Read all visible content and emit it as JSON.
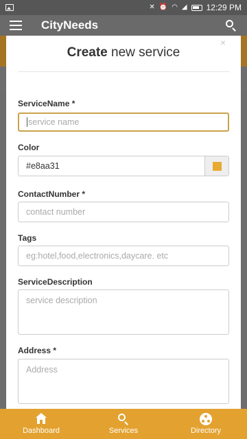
{
  "status_bar": {
    "time": "12:29 PM"
  },
  "app_bar": {
    "title": "CityNeeds"
  },
  "dialog": {
    "title_bold": "Create",
    "title_rest": " new service",
    "close": "×",
    "fields": {
      "service_name": {
        "label": "ServiceName *",
        "placeholder": "service name"
      },
      "color": {
        "label": "Color",
        "value": "#e8aa31"
      },
      "contact_number": {
        "label": "ContactNumber *",
        "placeholder": "contact number"
      },
      "tags": {
        "label": "Tags",
        "placeholder": "eg:hotel,food,electronics,daycare. etc"
      },
      "service_description": {
        "label": "ServiceDescription",
        "placeholder": "service description"
      },
      "address": {
        "label": "Address *",
        "placeholder": "Address"
      }
    }
  },
  "bottom_nav": {
    "items": [
      {
        "label": "Dashboard",
        "icon": "home-icon"
      },
      {
        "label": "Services",
        "icon": "search-icon"
      },
      {
        "label": "Directory",
        "icon": "directory-icon"
      }
    ]
  },
  "colors": {
    "accent": "#e3a230",
    "swatch": "#e8aa31",
    "focus_border": "#c9a34a"
  }
}
